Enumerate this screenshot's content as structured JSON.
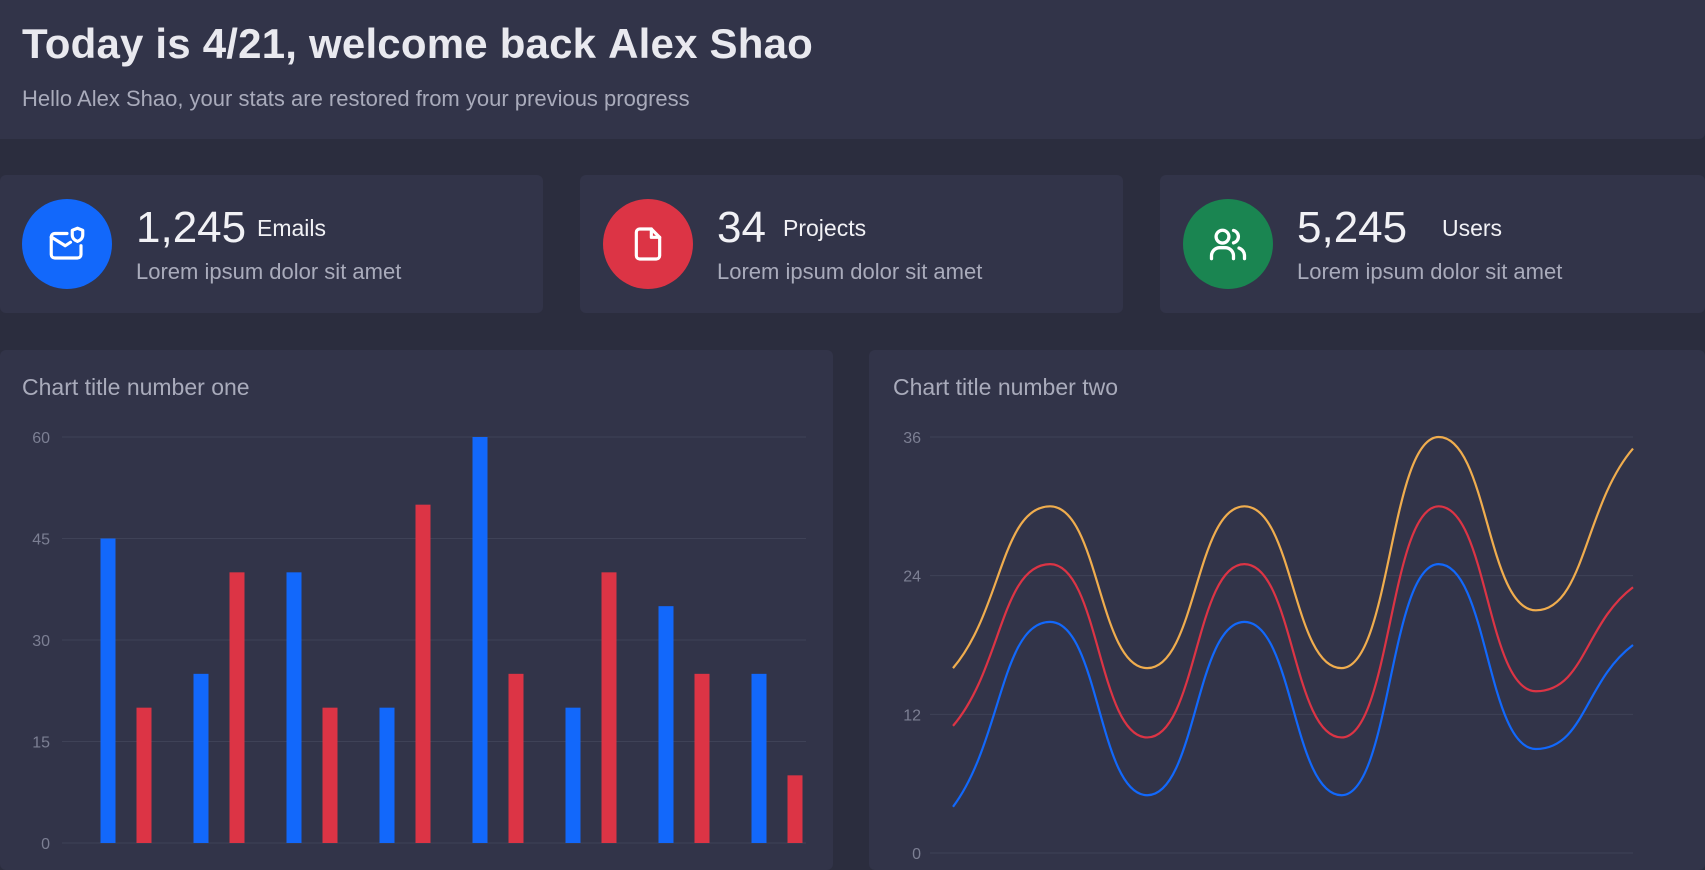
{
  "header": {
    "title_prefix": "Today is 4/21, welcome back ",
    "title_name": "Alex Shao",
    "subtitle": "Hello Alex Shao, your stats are restored from your previous progress"
  },
  "stats": [
    {
      "value": "1,245",
      "label": "Emails",
      "description": "Lorem ipsum dolor sit amet",
      "icon": "mail-shield-icon",
      "color": "#1268fb"
    },
    {
      "value": "34",
      "label": "Projects",
      "description": "Lorem ipsum dolor sit amet",
      "icon": "file-icon",
      "color": "#dc3445"
    },
    {
      "value": "5,245",
      "label": "Users",
      "description": "Lorem ipsum dolor sit amet",
      "icon": "users-icon",
      "color": "#1a8551"
    }
  ],
  "charts": {
    "one_title": "Chart title number one",
    "two_title": "Chart title number two"
  },
  "chart_data": [
    {
      "type": "bar",
      "title": "Chart title number one",
      "ylim": [
        0,
        60
      ],
      "yticks": [
        0,
        15,
        30,
        45,
        60
      ],
      "grid": true,
      "colors": [
        "#1268fb",
        "#dc3445"
      ],
      "series": [
        {
          "values": [
            45,
            25,
            40,
            20,
            60,
            20,
            35,
            25
          ]
        },
        {
          "values": [
            20,
            40,
            20,
            50,
            25,
            40,
            25,
            10
          ]
        }
      ]
    },
    {
      "type": "line",
      "title": "Chart title number two",
      "ylim": [
        0,
        36
      ],
      "yticks": [
        0,
        12,
        24,
        36
      ],
      "grid": true,
      "colors": [
        "#f0ad4e",
        "#dc3445",
        "#1268fb"
      ],
      "x": [
        0,
        1,
        2,
        3,
        4,
        5,
        6,
        7
      ],
      "series": [
        {
          "values": [
            16,
            30,
            16,
            30,
            16,
            36,
            21,
            35
          ]
        },
        {
          "values": [
            11,
            25,
            10,
            25,
            10,
            30,
            14,
            23
          ]
        },
        {
          "values": [
            4,
            20,
            5,
            20,
            5,
            25,
            9,
            18
          ]
        }
      ]
    }
  ]
}
